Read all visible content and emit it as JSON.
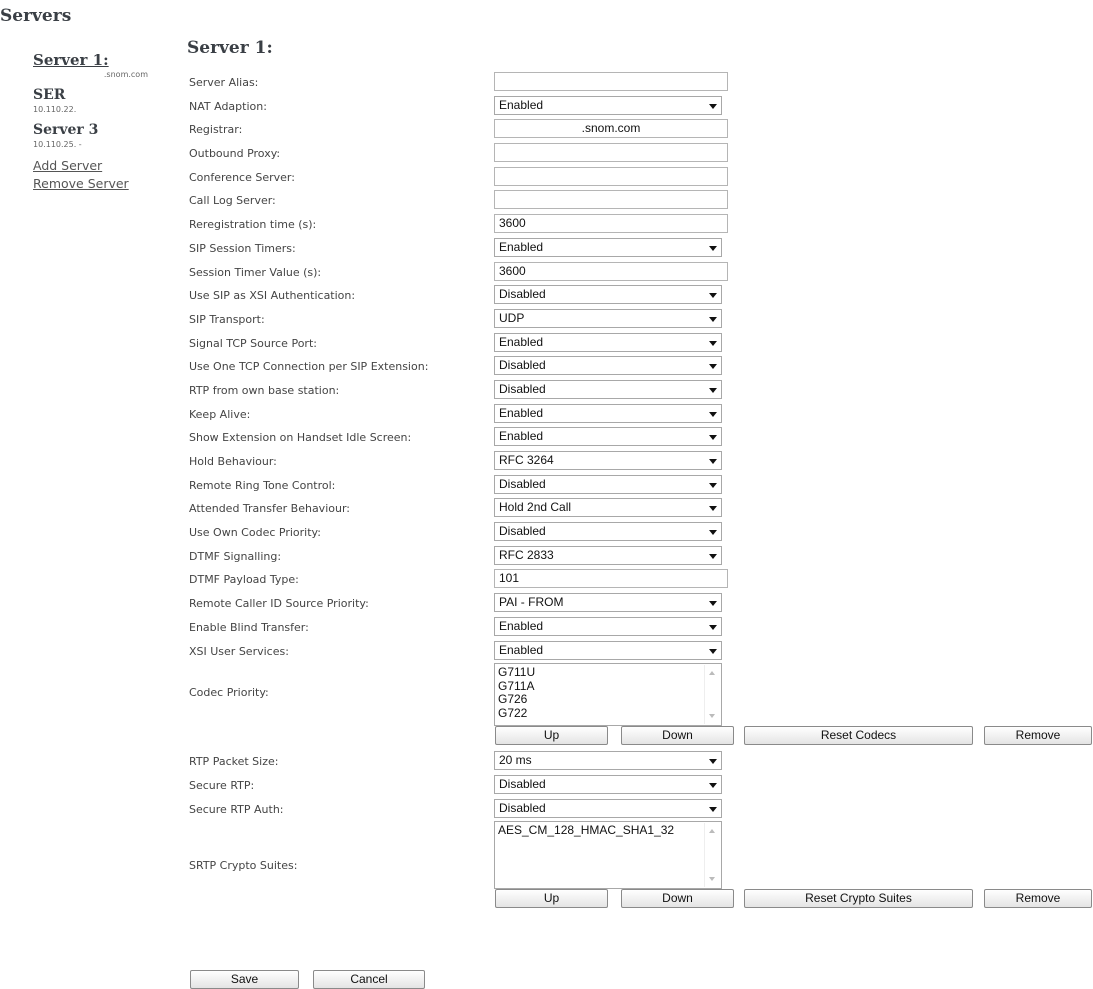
{
  "page": {
    "title": "Servers"
  },
  "sidebar": {
    "servers": [
      {
        "name": "Server 1:",
        "address": ".snom.com"
      },
      {
        "name": "SER",
        "address": "10.110.22."
      },
      {
        "name": "Server 3",
        "address": "10.110.25. -"
      }
    ],
    "add_label": "Add Server",
    "remove_label": "Remove Server"
  },
  "main": {
    "title": "Server 1:"
  },
  "fields": [
    {
      "label": "Server Alias:",
      "kind": "text",
      "value": ""
    },
    {
      "label": "NAT Adaption:",
      "kind": "select",
      "value": "Enabled"
    },
    {
      "label": "Registrar:",
      "kind": "text",
      "value": ".snom.com",
      "center": true
    },
    {
      "label": "Outbound Proxy:",
      "kind": "text",
      "value": ""
    },
    {
      "label": "Conference Server:",
      "kind": "text",
      "value": ""
    },
    {
      "label": "Call Log Server:",
      "kind": "text",
      "value": ""
    },
    {
      "label": "Reregistration time (s):",
      "kind": "text",
      "value": "3600"
    },
    {
      "label": "SIP Session Timers:",
      "kind": "select",
      "value": "Enabled"
    },
    {
      "label": "Session Timer Value (s):",
      "kind": "text",
      "value": "3600"
    },
    {
      "label": "Use SIP as XSI Authentication:",
      "kind": "select",
      "value": "Disabled"
    },
    {
      "label": "SIP Transport:",
      "kind": "select",
      "value": "UDP"
    },
    {
      "label": "Signal TCP Source Port:",
      "kind": "select",
      "value": "Enabled"
    },
    {
      "label": "Use One TCP Connection per SIP Extension:",
      "kind": "select",
      "value": "Disabled"
    },
    {
      "label": "RTP from own base station:",
      "kind": "select",
      "value": "Disabled"
    },
    {
      "label": "Keep Alive:",
      "kind": "select",
      "value": "Enabled"
    },
    {
      "label": "Show Extension on Handset Idle Screen:",
      "kind": "select",
      "value": "Enabled"
    },
    {
      "label": "Hold Behaviour:",
      "kind": "select",
      "value": "RFC 3264"
    },
    {
      "label": "Remote Ring Tone Control:",
      "kind": "select",
      "value": "Disabled"
    },
    {
      "label": "Attended Transfer Behaviour:",
      "kind": "select",
      "value": "Hold 2nd Call"
    },
    {
      "label": "Use Own Codec Priority:",
      "kind": "select",
      "value": "Disabled"
    },
    {
      "label": "DTMF Signalling:",
      "kind": "select",
      "value": "RFC 2833"
    },
    {
      "label": "DTMF Payload Type:",
      "kind": "text",
      "value": "101"
    },
    {
      "label": "Remote Caller ID Source Priority:",
      "kind": "select",
      "value": "PAI - FROM"
    },
    {
      "label": "Enable Blind Transfer:",
      "kind": "select",
      "value": "Enabled"
    },
    {
      "label": "XSI User Services:",
      "kind": "select",
      "value": "Enabled"
    }
  ],
  "codec": {
    "label": "Codec Priority:",
    "items": [
      "G711U",
      "G711A",
      "G726",
      "G722"
    ],
    "buttons": {
      "up": "Up",
      "down": "Down",
      "reset": "Reset Codecs",
      "remove": "Remove"
    }
  },
  "fields2": [
    {
      "label": "RTP Packet Size:",
      "kind": "select",
      "value": "20 ms"
    },
    {
      "label": "Secure RTP:",
      "kind": "select",
      "value": "Disabled"
    },
    {
      "label": "Secure RTP Auth:",
      "kind": "select",
      "value": "Disabled"
    }
  ],
  "crypto": {
    "label": "SRTP Crypto Suites:",
    "items": [
      "AES_CM_128_HMAC_SHA1_32"
    ],
    "buttons": {
      "up": "Up",
      "down": "Down",
      "reset": "Reset Crypto Suites",
      "remove": "Remove"
    }
  },
  "actions": {
    "save": "Save",
    "cancel": "Cancel"
  }
}
